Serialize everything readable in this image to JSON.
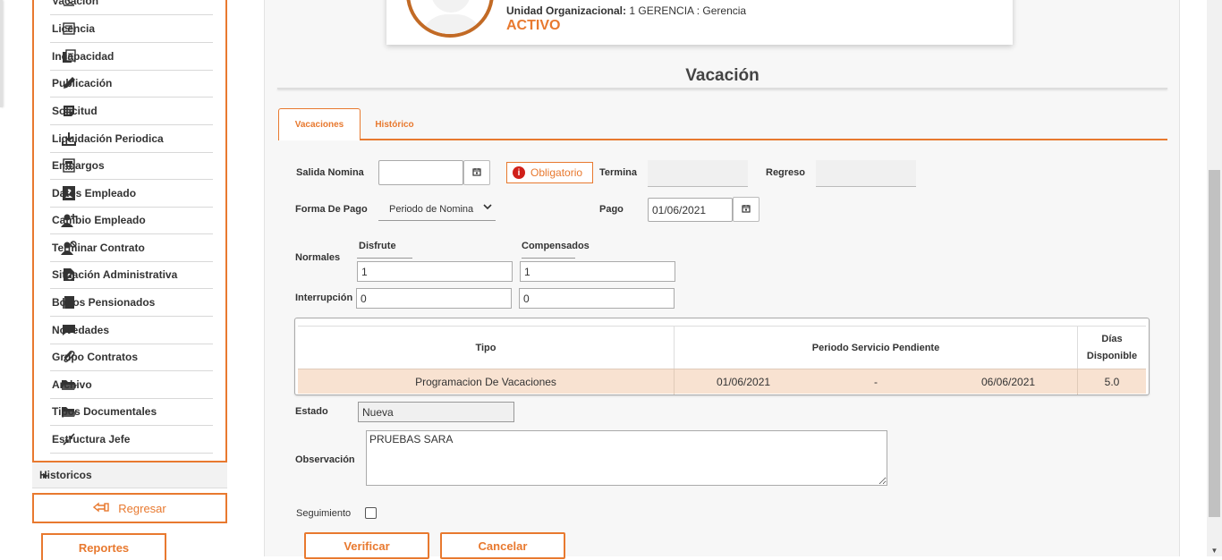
{
  "sidebar": {
    "items": [
      {
        "label": "Vacación",
        "icon": "beach-icon"
      },
      {
        "label": "Licencia",
        "icon": "list-doc-icon"
      },
      {
        "label": "Incapacidad",
        "icon": "copy-doc-icon"
      },
      {
        "label": "Publicación",
        "icon": "pencil-icon"
      },
      {
        "label": "Solicitud",
        "icon": "note-icon"
      },
      {
        "label": "Liquidación Periodica",
        "icon": "download-icon"
      },
      {
        "label": "Embargos",
        "icon": "calculator-icon"
      },
      {
        "label": "Datos Empleado",
        "icon": "contact-icon"
      },
      {
        "label": "Cambio Empleado",
        "icon": "user-edit-icon"
      },
      {
        "label": "Terminar Contrato",
        "icon": "user-block-icon"
      },
      {
        "label": "Situación Administrativa",
        "icon": "doc-gear-icon"
      },
      {
        "label": "Bonos Pensionados",
        "icon": "book-icon"
      },
      {
        "label": "Novedades",
        "icon": "chat-icon"
      },
      {
        "label": "Grupo Contratos",
        "icon": "paperclip-icon"
      },
      {
        "label": "Archivo",
        "icon": "folder-open-icon"
      },
      {
        "label": "Tipos Documentales",
        "icon": "folder-open-icon"
      },
      {
        "label": "Estructura Jefe",
        "icon": "collapse-icon"
      }
    ],
    "historicos_label": "Historicos",
    "regresar_label": "Regresar",
    "reportes_label": "Reportes"
  },
  "employee": {
    "unit_label": "Unidad Organizacional:",
    "unit_value": "1 GERENCIA : Gerencia",
    "status": "ACTIVO"
  },
  "page": {
    "title": "Vacación",
    "tabs": [
      {
        "label": "Vacaciones",
        "active": true
      },
      {
        "label": "Histórico",
        "active": false
      }
    ]
  },
  "form": {
    "salida_nomina_label": "Salida Nomina",
    "salida_nomina_value": "",
    "obligatorio_label": "Obligatorio",
    "termina_label": "Termina",
    "termina_value": "",
    "regreso_label": "Regreso",
    "regreso_value": "",
    "forma_pago_label": "Forma De Pago",
    "forma_pago_value": "Periodo de Nomina",
    "pago_label": "Pago",
    "pago_value": "01/06/2021",
    "disfrute_label": "Disfrute",
    "compensados_label": "Compensados",
    "normales_label": "Normales",
    "normales_disfrute": "1",
    "normales_compensados": "1",
    "interrupcion_label": "Interrupción",
    "interrupcion_disfrute": "0",
    "interrupcion_compensados": "0",
    "estado_label": "Estado",
    "estado_value": "Nueva",
    "observacion_label": "Observación",
    "observacion_value": "PRUEBAS SARA",
    "seguimiento_label": "Seguimiento",
    "seguimiento_checked": false
  },
  "table": {
    "headers": {
      "tipo": "Tipo",
      "periodo": "Periodo Servicio Pendiente",
      "dias_line1": "Días",
      "dias_line2": "Disponible"
    },
    "rows": [
      {
        "tipo": "Programacion De Vacaciones",
        "desde": "01/06/2021",
        "sep": "-",
        "hasta": "06/06/2021",
        "dias": "5.0"
      }
    ]
  },
  "actions": {
    "verificar": "Verificar",
    "cancelar": "Cancelar"
  },
  "colors": {
    "accent": "#e8792f",
    "row_highlight": "#f8e2d1",
    "error": "#d0201a"
  }
}
